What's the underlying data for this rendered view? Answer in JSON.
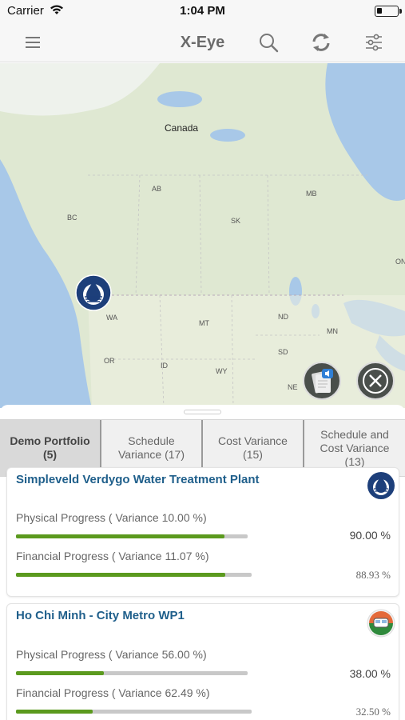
{
  "status_bar": {
    "carrier": "Carrier",
    "time": "1:04 PM",
    "battery_level": 0.25
  },
  "nav": {
    "title": "X-Eye"
  },
  "icons": [
    "menu-icon",
    "search-icon",
    "refresh-icon",
    "filter-icon",
    "wifi-icon",
    "water-drop-icon",
    "audio-document-icon",
    "close-icon"
  ],
  "map": {
    "labels": {
      "canada": "Canada",
      "ab": "AB",
      "mb": "MB",
      "bc": "BC",
      "sk": "SK",
      "on": "ON",
      "wa": "WA",
      "mt": "MT",
      "nd": "ND",
      "mn": "MN",
      "or": "OR",
      "id": "ID",
      "sd": "SD",
      "wy": "WY",
      "ne": "NE"
    }
  },
  "tabs": [
    {
      "label": "Demo Portfolio\n(5)",
      "active": true
    },
    {
      "label": "Schedule\nVariance (17)",
      "active": false
    },
    {
      "label": "Cost Variance\n(15)",
      "active": false
    },
    {
      "label": "Schedule and\nCost Variance\n(13)",
      "active": false
    }
  ],
  "projects": [
    {
      "title": "Simpleveld Verdygo Water Treatment Plant",
      "physical_label": "Physical Progress ( Variance 10.00 %)",
      "physical_value": "90.00 %",
      "physical_progress": 0.9,
      "financial_label": "Financial Progress ( Variance 11.07 %)",
      "financial_value": "88.93 %",
      "financial_progress": 0.8893
    },
    {
      "title": "Ho Chi Minh - City Metro WP1",
      "physical_label": "Physical Progress ( Variance 56.00 %)",
      "physical_value": "38.00 %",
      "physical_progress": 0.38,
      "financial_label": "Financial Progress ( Variance 62.49 %)",
      "financial_value": "32.50 %",
      "financial_progress": 0.325
    }
  ],
  "colors": {
    "accent_title": "#1f5f8b",
    "progress_fill": "#5b9a1e",
    "progress_track": "#c8c8c8",
    "map_land": "#dfe8d2",
    "map_water": "#a8c8e8"
  }
}
